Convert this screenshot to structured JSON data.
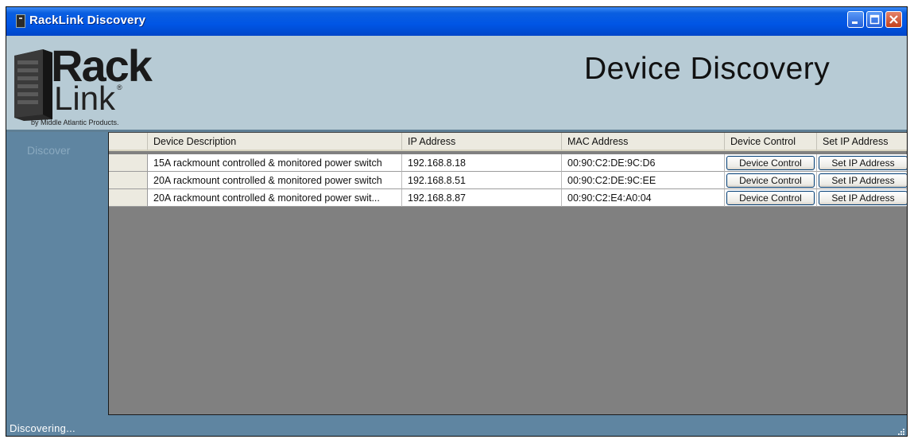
{
  "window": {
    "title": "RackLink Discovery"
  },
  "titlebar_buttons": {
    "minimize_icon": "minimize-icon",
    "maximize_icon": "maximize-icon",
    "close_icon": "close-icon"
  },
  "logo": {
    "rack": "Rack",
    "link": "Link",
    "reg": "®",
    "tagline": "by Middle Atlantic Products."
  },
  "header": {
    "heading": "Device Discovery"
  },
  "sidebar": {
    "items": [
      {
        "label": "Discover"
      }
    ]
  },
  "table": {
    "columns": [
      "Device Description",
      "IP Address",
      "MAC Address",
      "Device Control",
      "Set IP Address"
    ],
    "rows": [
      {
        "description": "15A rackmount controlled & monitored power switch",
        "ip": "192.168.8.18",
        "mac": "00:90:C2:DE:9C:D6",
        "control_label": "Device Control",
        "setip_label": "Set IP Address"
      },
      {
        "description": "20A rackmount controlled & monitored power switch",
        "ip": "192.168.8.51",
        "mac": "00:90:C2:DE:9C:EE",
        "control_label": "Device Control",
        "setip_label": "Set IP Address"
      },
      {
        "description": "20A rackmount controlled & monitored power swit...",
        "ip": "192.168.8.87",
        "mac": "00:90:C2:E4:A0:04",
        "control_label": "Device Control",
        "setip_label": "Set IP Address"
      }
    ]
  },
  "status": {
    "text": "Discovering..."
  },
  "colors": {
    "titlebar": "#0055e5",
    "header": "#b7cbd5",
    "body": "#5f85a1",
    "grid_bg": "#808080"
  }
}
